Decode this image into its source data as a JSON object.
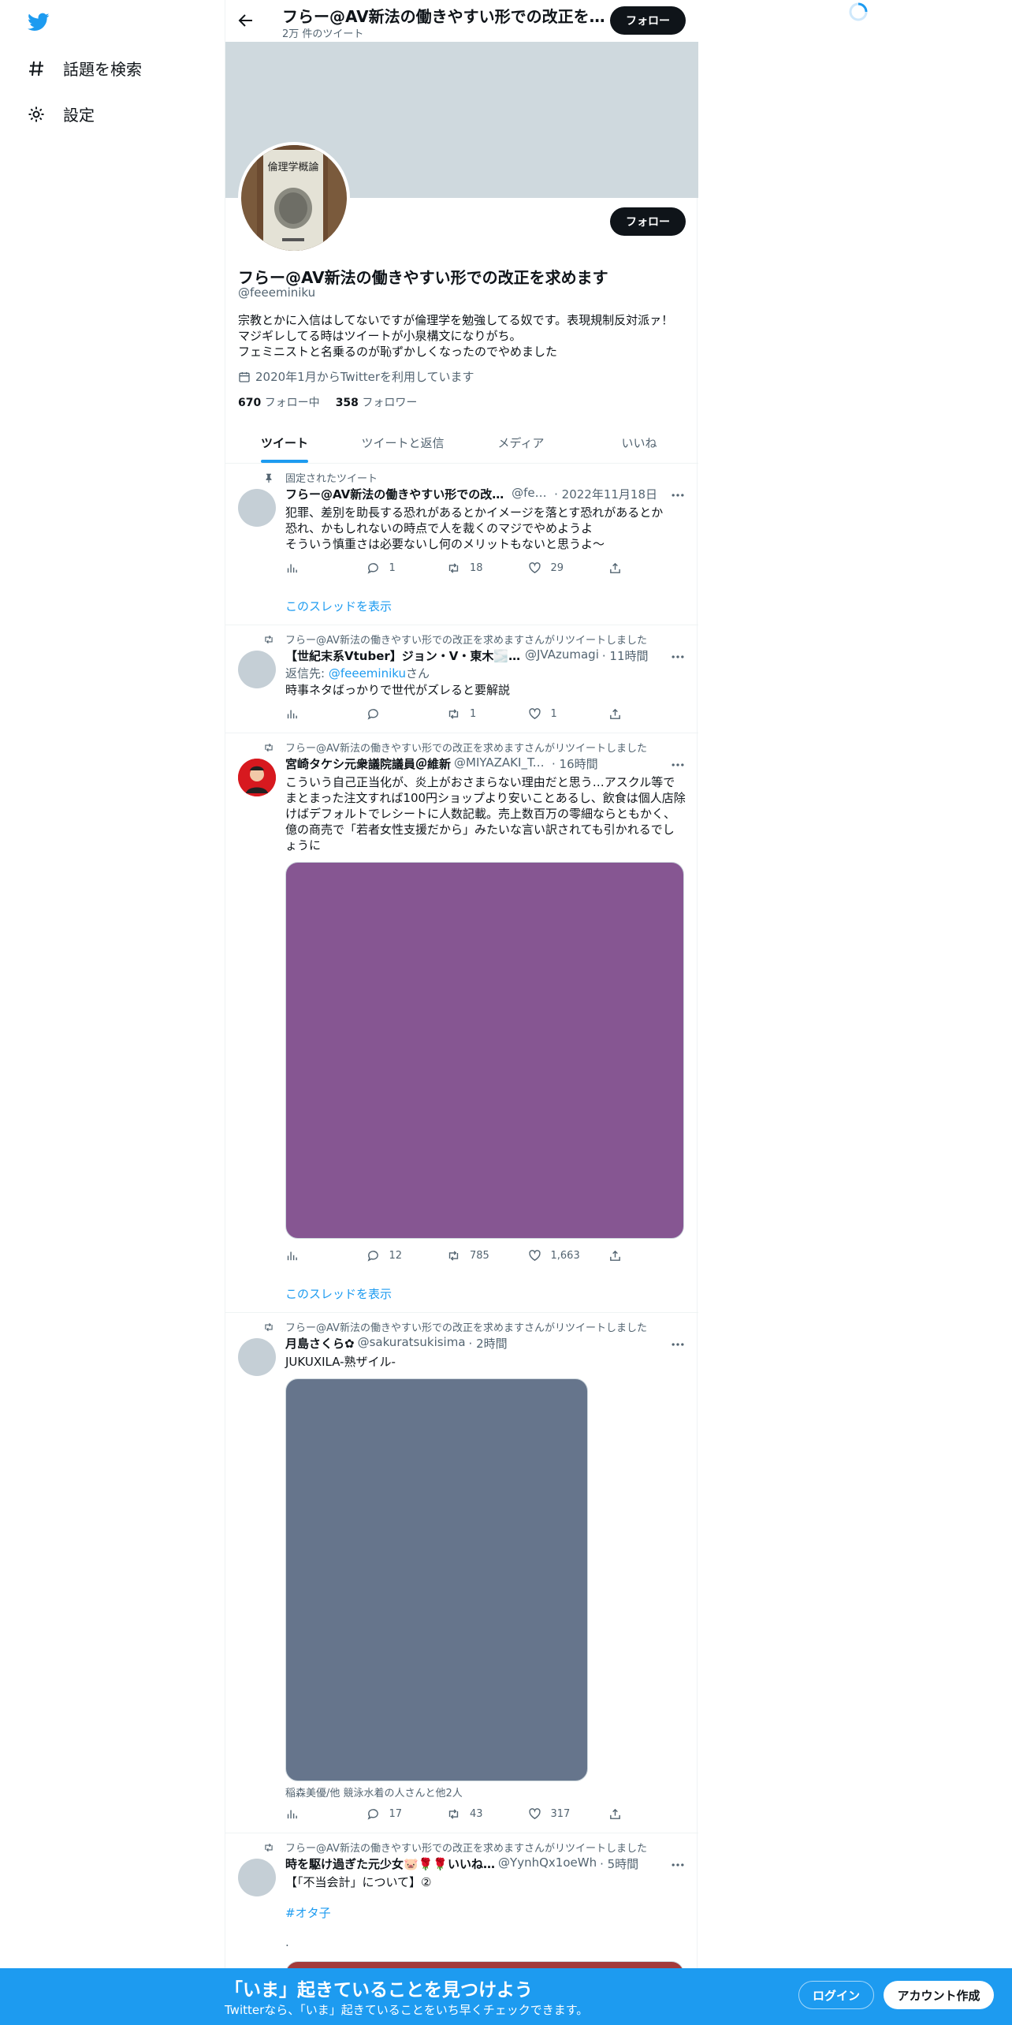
{
  "nav": {
    "explore_label": "話題を検索",
    "settings_label": "設定"
  },
  "header": {
    "title": "フらー@AV新法の働きやすい形での改正を求めます",
    "tweet_count": "2万 件のツイート",
    "follow_label": "フォロー"
  },
  "profile": {
    "follow_label": "フォロー",
    "name": "フらー@AV新法の働きやすい形での改正を求めます",
    "handle": "@feeeminiku",
    "bio": [
      "宗教とかに入信はしてないですが倫理学を勉強してる奴です。表現規制反対派ァ！",
      "マジギレしてる時はツイートが小泉構文になりがち。",
      "フェミニストと名乗るのが恥ずかしくなったのでやめました"
    ],
    "joined": "2020年1月からTwitterを利用しています",
    "following_count": "670",
    "following_label": "フォロー中",
    "followers_count": "358",
    "followers_label": "フォロワー",
    "avatar_book_title": "倫理学概論"
  },
  "tabs": [
    "ツイート",
    "ツイートと返信",
    "メディア",
    "いいね"
  ],
  "tweets": [
    {
      "social": "固定されたツイート",
      "name": "フらー@AV新法の働きやすい形での改正を求めます",
      "handle": "@feeeminiku",
      "time": "· 2022年11月18日",
      "text": [
        "犯罪、差別を助長する恐れがあるとかイメージを落とす恐れがあるとか",
        "恐れ、かもしれないの時点で人を裁くのマジでやめようよ",
        "そういう慎重さは必要ないし何のメリットもないと思うよ〜"
      ],
      "replies": "1",
      "retweets": "18",
      "likes": "29",
      "show_thread": "このスレッドを表示"
    },
    {
      "social": "フらー@AV新法の働きやすい形での改正を求めますさんがリツイートしました",
      "name": "【世紀末系Vtuber】ジョン・V・東木🌫️🤠",
      "handle": "@JVAzumagi",
      "time": "· 11時間",
      "reply_prefix": "返信先: ",
      "reply_target": "@feeeminiku",
      "reply_suffix": "さん",
      "text": [
        "時事ネタばっかりで世代がズレると要解説"
      ],
      "replies": "",
      "retweets": "1",
      "likes": "1"
    },
    {
      "social": "フらー@AV新法の働きやすい形での改正を求めますさんがリツイートしました",
      "name": "宮崎タケシ元衆議院議員＠維新",
      "handle": "@MIYAZAKI_Takesh",
      "time": "· 16時間",
      "text": [
        "こういう自己正当化が、炎上がおさまらない理由だと思う…アスクル等で",
        "まとまった注文すれば100円ショップより安いことあるし、飲食は個人店除",
        "けばデフォルトでレシートに人数記載。売上数百万の零細ならともかく、",
        "億の商売で「若者女性支援だから」みたいな言い訳されても引かれるでし",
        "ょうに"
      ],
      "replies": "12",
      "retweets": "785",
      "likes": "1,663",
      "media_color": "#865692",
      "show_thread": "このスレッドを表示"
    },
    {
      "social": "フらー@AV新法の働きやすい形での改正を求めますさんがリツイートしました",
      "name": "月島さくら✿",
      "handle": "@sakuratsukisima",
      "time": "· 2時間",
      "text": [
        "JUKUXILA-熟ザイル-"
      ],
      "media_color": "#66758c",
      "tagged": "稲森美優/他 競泳水着の人さんと他2人",
      "replies": "17",
      "retweets": "43",
      "likes": "317"
    },
    {
      "social": "フらー@AV新法の働きやすい形での改正を求めますさんがリツイートしました",
      "name": "時を駆け過ぎた元少女🐷🌹🌹いいね…",
      "handle": "@YynhQx1oeWh",
      "time": "· 5時間",
      "text": [
        "【「不当会計」について】②"
      ],
      "hashtag": "#オタ子",
      "dot": "."
    }
  ],
  "bottom": {
    "title": "「いま」起きていることを見つけよう",
    "subtitle": "Twitterなら、「いま」起きていることをいち早くチェックできます。",
    "login": "ログイン",
    "signup": "アカウント作成"
  },
  "colors": {
    "accent": "#1d9bf0",
    "banner": "#cfd9de"
  },
  "icons": [
    "twitter-logo",
    "hashtag-icon",
    "gear-icon",
    "back-arrow-icon",
    "pin-icon",
    "retweet-icon",
    "more-icon",
    "analytics-icon",
    "reply-icon",
    "like-icon",
    "share-icon",
    "calendar-icon",
    "spinner-icon"
  ]
}
